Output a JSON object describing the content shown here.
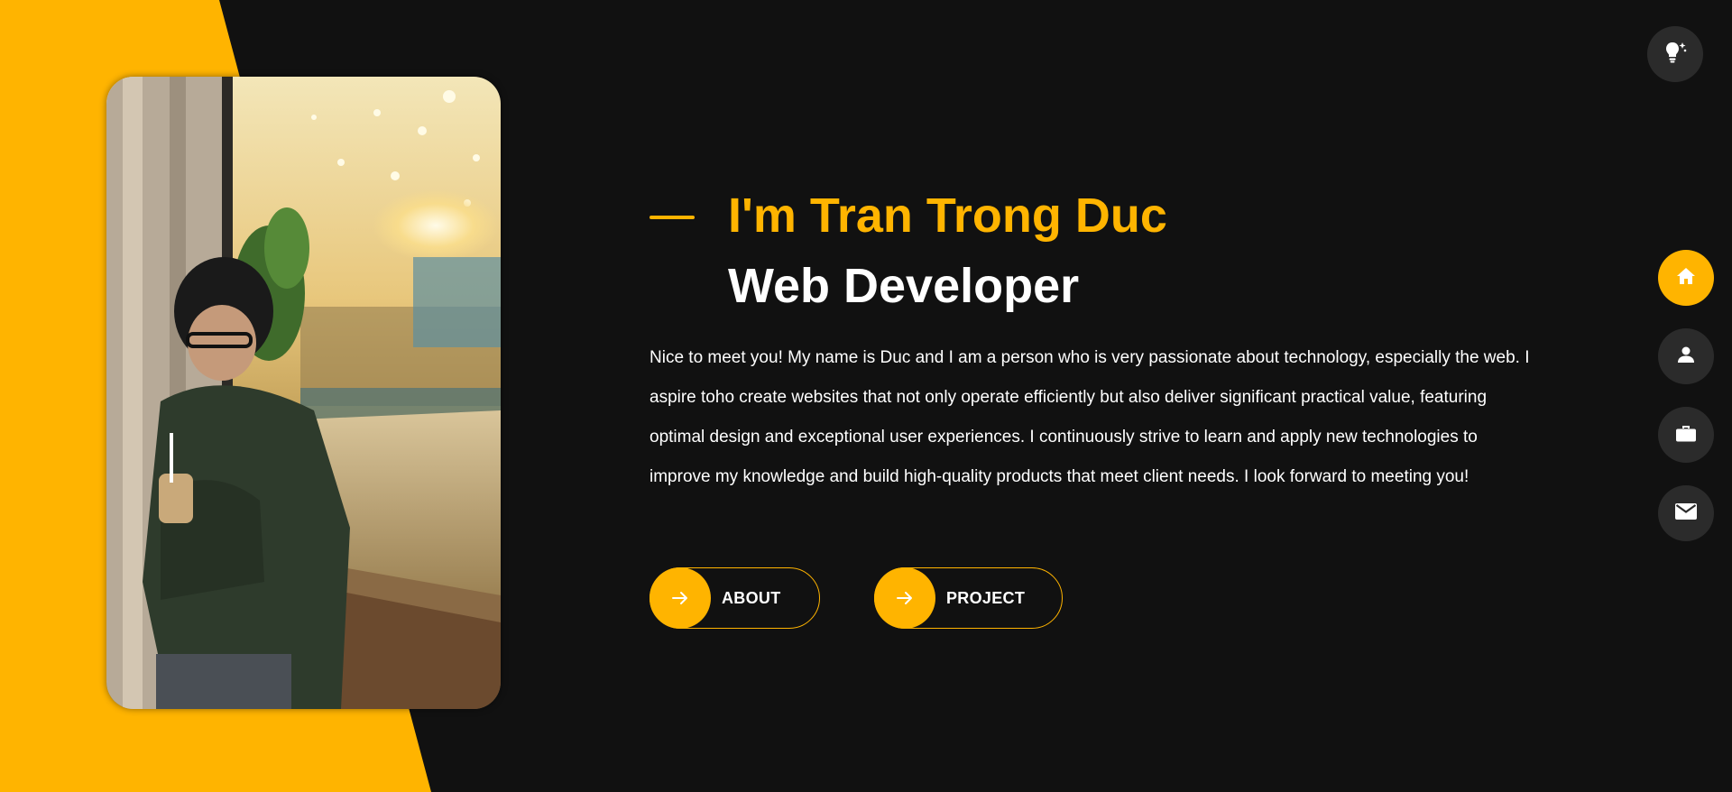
{
  "hero": {
    "name": "I'm Tran Trong Duc",
    "role": "Web Developer",
    "intro": "Nice to meet you! My name is Duc and I am a person who is very passionate about technology, especially the web. I aspire toho create websites that not only operate efficiently but also deliver significant practical value, featuring optimal design and exceptional user experiences. I continuously strive to learn and apply new technologies to improve my knowledge and build high-quality products that meet client needs. I look forward to meeting you!"
  },
  "buttons": {
    "about_label": "ABOUT",
    "project_label": "PROJECT",
    "icon": "arrow-right-icon"
  },
  "theme_toggle": {
    "icon": "lightbulb-icon"
  },
  "side_nav": {
    "items": [
      {
        "icon": "home-icon",
        "active": true
      },
      {
        "icon": "user-icon",
        "active": false
      },
      {
        "icon": "briefcase-icon",
        "active": false
      },
      {
        "icon": "mail-icon",
        "active": false
      }
    ]
  },
  "colors": {
    "accent": "#ffb400",
    "background": "#111111",
    "button_dark": "#2b2b2b",
    "text": "#ffffff"
  }
}
